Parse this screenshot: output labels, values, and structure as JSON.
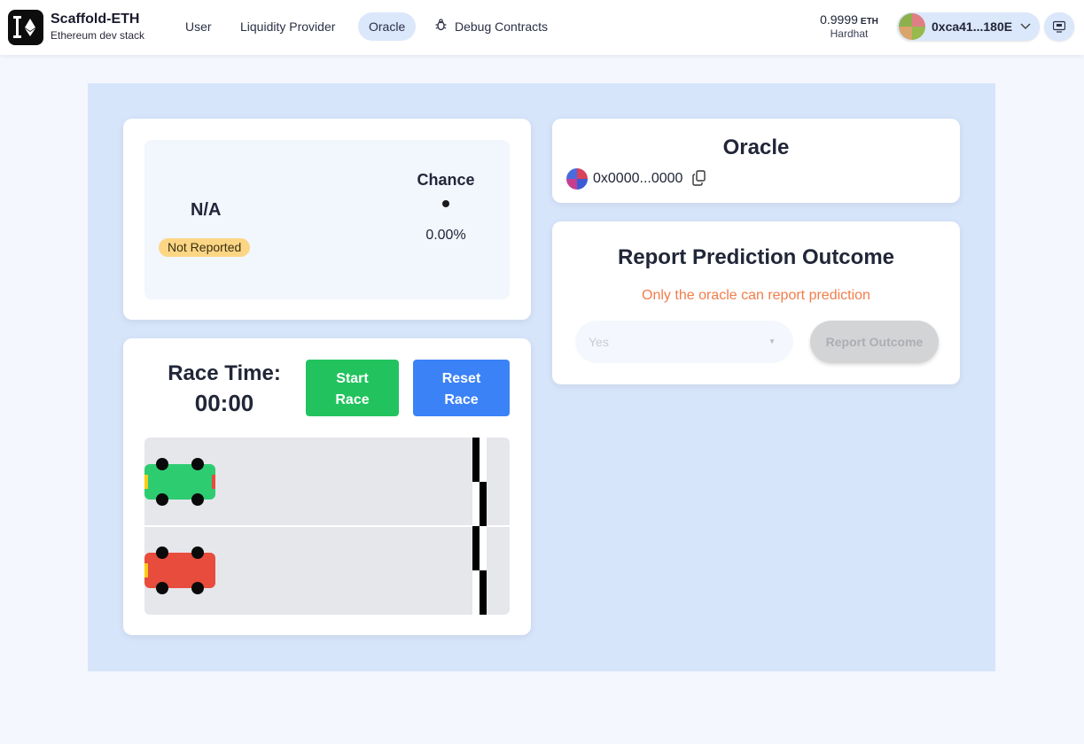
{
  "header": {
    "brand_title": "Scaffold-ETH",
    "brand_subtitle": "Ethereum dev stack",
    "nav": [
      {
        "label": "User"
      },
      {
        "label": "Liquidity Provider"
      },
      {
        "label": "Oracle",
        "active": true
      },
      {
        "label": "Debug Contracts",
        "icon": "bug-icon"
      }
    ],
    "balance": {
      "amount": "0.9999",
      "unit": "ETH",
      "network": "Hardhat"
    },
    "account": {
      "address": "0xca41...180E",
      "icon": "chevron-down-icon"
    },
    "qr_icon": "qrcode-icon"
  },
  "prediction": {
    "value": "N/A",
    "status": "Not Reported",
    "chance_label": "Chance",
    "chance_value": "0.00%"
  },
  "race": {
    "time_label": "Race Time:",
    "time_value": "00:00",
    "start_line1": "Start",
    "start_line2": "Race",
    "reset_line1": "Reset",
    "reset_line2": "Race",
    "cars": [
      {
        "name": "green-car",
        "color": "#2ecc71",
        "front_color": "#e74c3c"
      },
      {
        "name": "red-car",
        "color": "#e74c3c",
        "front_color": "#e74c3c"
      }
    ]
  },
  "oracle": {
    "title": "Oracle",
    "address": "0x0000...0000"
  },
  "report": {
    "title": "Report Prediction Outcome",
    "note": "Only the oracle can report prediction",
    "select_value": "Yes",
    "button_label": "Report Outcome"
  },
  "colors": {
    "accent": "#dbe7fb",
    "panel_bg": "#d7e5fb",
    "start_btn": "#22c35e",
    "reset_btn": "#3b82f6",
    "warning_text": "#f07d4a",
    "badge": "#fcd685"
  }
}
